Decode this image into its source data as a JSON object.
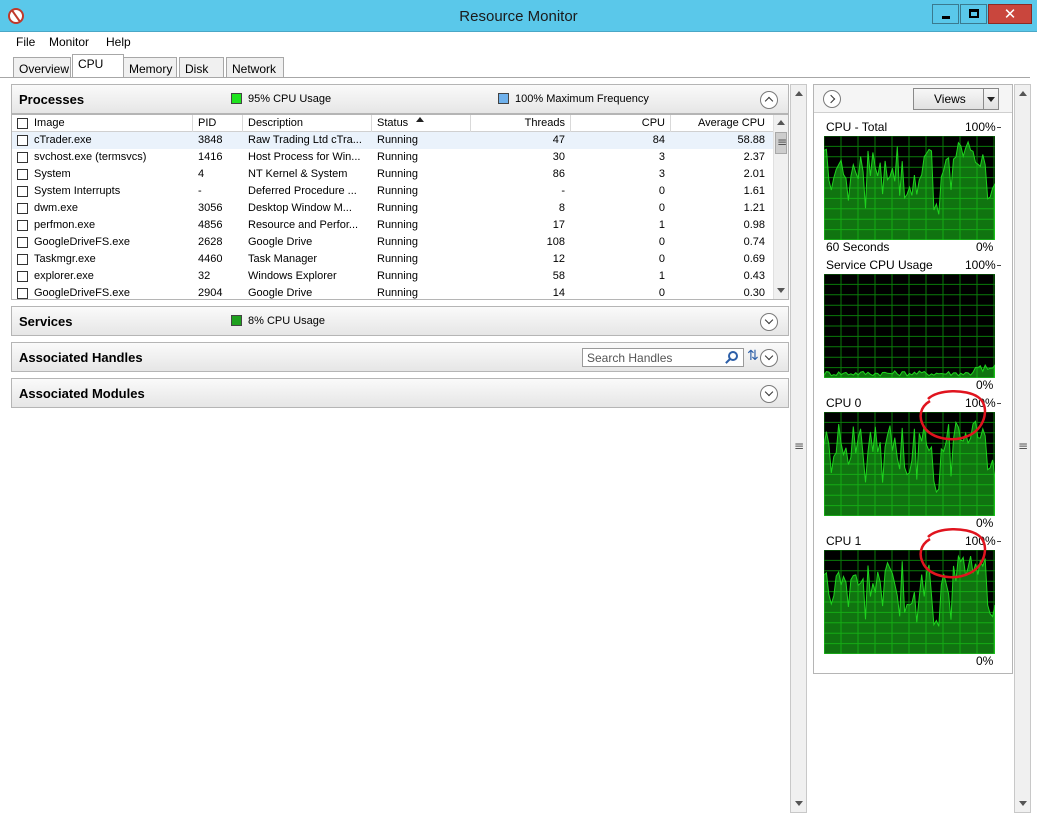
{
  "window": {
    "title": "Resource Monitor",
    "controls": [
      "minimize",
      "maximize",
      "close"
    ],
    "close_glyph": "✕"
  },
  "menu": [
    "File",
    "Monitor",
    "Help"
  ],
  "tabs": [
    {
      "label": "Overview",
      "active": false
    },
    {
      "label": "CPU",
      "active": true
    },
    {
      "label": "Memory",
      "active": false
    },
    {
      "label": "Disk",
      "active": false
    },
    {
      "label": "Network",
      "active": false
    }
  ],
  "processes": {
    "title": "Processes",
    "cpu_usage": "95% CPU Usage",
    "cpu_usage_color": "#1ee31e",
    "max_frequency": "100% Maximum Frequency",
    "max_frequency_color": "#6fb1ec",
    "columns": [
      "Image",
      "PID",
      "Description",
      "Status",
      "Threads",
      "CPU",
      "Average CPU"
    ],
    "sort_column": "Status",
    "rows": [
      {
        "image": "cTrader.exe",
        "pid": "3848",
        "description": "Raw Trading Ltd cTra...",
        "status": "Running",
        "threads": "47",
        "cpu": "84",
        "avg_cpu": "58.88"
      },
      {
        "image": "svchost.exe (termsvcs)",
        "pid": "1416",
        "description": "Host Process for Win...",
        "status": "Running",
        "threads": "30",
        "cpu": "3",
        "avg_cpu": "2.37"
      },
      {
        "image": "System",
        "pid": "4",
        "description": "NT Kernel & System",
        "status": "Running",
        "threads": "86",
        "cpu": "3",
        "avg_cpu": "2.01"
      },
      {
        "image": "System Interrupts",
        "pid": "-",
        "description": "Deferred Procedure ...",
        "status": "Running",
        "threads": "-",
        "cpu": "0",
        "avg_cpu": "1.61"
      },
      {
        "image": "dwm.exe",
        "pid": "3056",
        "description": "Desktop Window M...",
        "status": "Running",
        "threads": "8",
        "cpu": "0",
        "avg_cpu": "1.21"
      },
      {
        "image": "perfmon.exe",
        "pid": "4856",
        "description": "Resource and Perfor...",
        "status": "Running",
        "threads": "17",
        "cpu": "1",
        "avg_cpu": "0.98"
      },
      {
        "image": "GoogleDriveFS.exe",
        "pid": "2628",
        "description": "Google Drive",
        "status": "Running",
        "threads": "108",
        "cpu": "0",
        "avg_cpu": "0.74"
      },
      {
        "image": "Taskmgr.exe",
        "pid": "4460",
        "description": "Task Manager",
        "status": "Running",
        "threads": "12",
        "cpu": "0",
        "avg_cpu": "0.69"
      },
      {
        "image": "explorer.exe",
        "pid": "32",
        "description": "Windows Explorer",
        "status": "Running",
        "threads": "58",
        "cpu": "1",
        "avg_cpu": "0.43"
      },
      {
        "image": "GoogleDriveFS.exe",
        "pid": "2904",
        "description": "Google Drive",
        "status": "Running",
        "threads": "14",
        "cpu": "0",
        "avg_cpu": "0.30"
      }
    ]
  },
  "services": {
    "title": "Services",
    "cpu_usage": "8% CPU Usage",
    "cpu_usage_color": "#1ea01e"
  },
  "handles": {
    "title": "Associated Handles",
    "search_placeholder": "Search Handles"
  },
  "modules": {
    "title": "Associated Modules"
  },
  "right_panel": {
    "views_label": "Views",
    "graphs": [
      {
        "title": "CPU - Total",
        "max": "100%",
        "min": "0%",
        "footer": "60 Seconds",
        "level": "high",
        "annotated": false
      },
      {
        "title": "Service CPU Usage",
        "max": "100%",
        "min": "0%",
        "footer": "",
        "level": "low",
        "annotated": false
      },
      {
        "title": "CPU 0",
        "max": "100%",
        "min": "0%",
        "footer": "",
        "level": "high",
        "annotated": true
      },
      {
        "title": "CPU 1",
        "max": "100%",
        "min": "0%",
        "footer": "",
        "level": "high",
        "annotated": true
      }
    ],
    "graph_color": "#1ed31e",
    "grid_color": "#0a7a0a",
    "annotation_color": "#e0141e"
  }
}
